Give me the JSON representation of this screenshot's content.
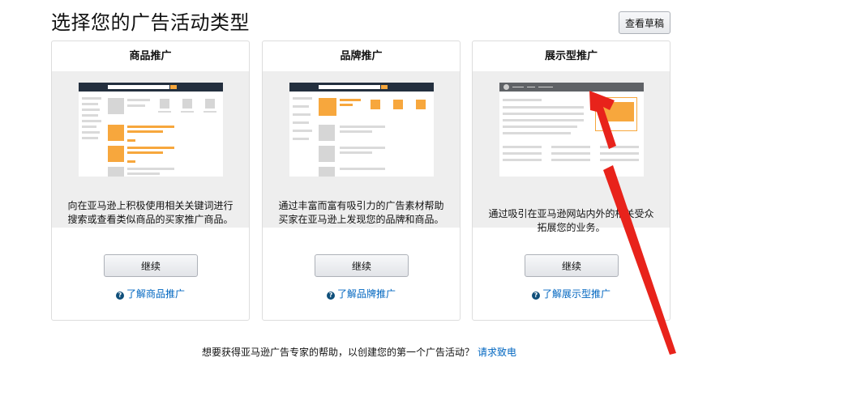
{
  "page": {
    "title": "选择您的广告活动类型",
    "draft_button": "查看草稿"
  },
  "cards": [
    {
      "title": "商品推广",
      "description": "向在亚马逊上积极使用相关关键词进行搜索或查看类似商品的买家推广商品。",
      "continue_label": "继续",
      "learn_more": "了解商品推广"
    },
    {
      "title": "品牌推广",
      "description": "通过丰富而富有吸引力的广告素材帮助买家在亚马逊上发现您的品牌和商品。",
      "continue_label": "继续",
      "learn_more": "了解品牌推广"
    },
    {
      "title": "展示型推广",
      "description": "通过吸引在亚马逊网站内外的相关受众拓展您的业务。",
      "continue_label": "继续",
      "learn_more": "了解展示型推广"
    }
  ],
  "footer": {
    "text": "想要获得亚马逊广告专家的帮助，以创建您的第一个广告活动？",
    "link": "请求致电"
  },
  "colors": {
    "accent_orange": "#f7a73d",
    "link_blue": "#0066c0",
    "annotation_red": "#e8231b"
  },
  "icons": {
    "help": "help-circle-icon",
    "annotation": "red-arrow-annotation"
  }
}
